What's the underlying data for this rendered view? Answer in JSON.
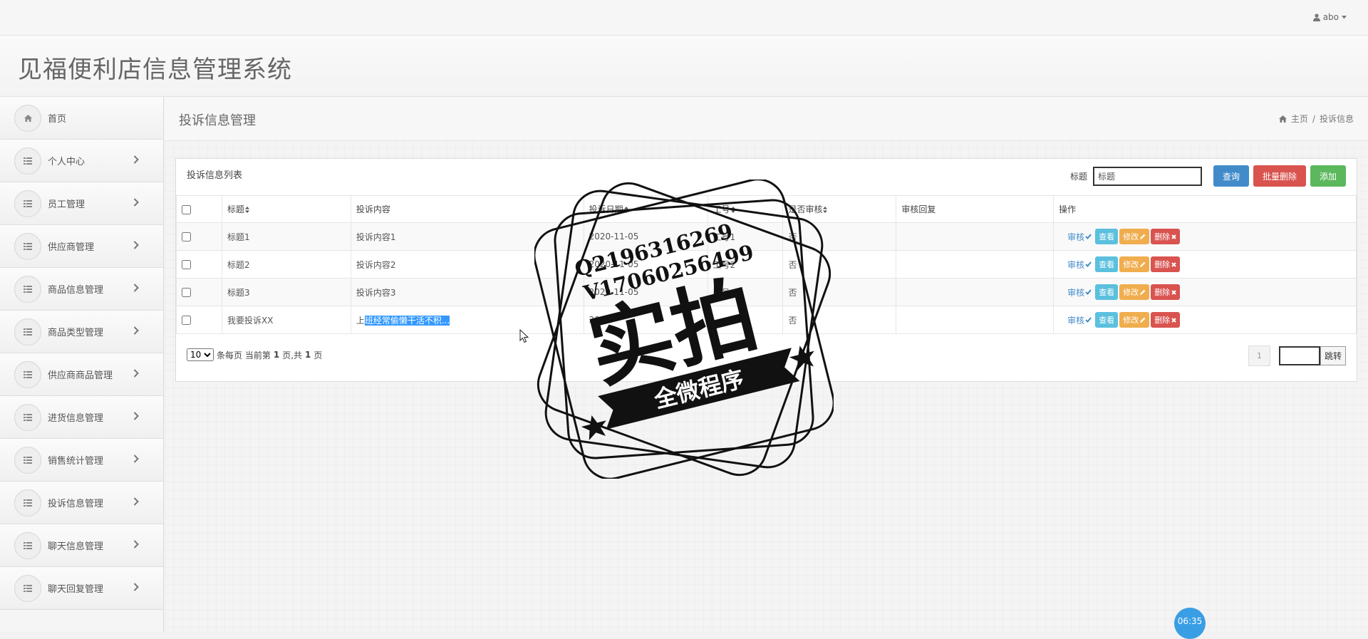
{
  "topbar": {
    "user": "abo"
  },
  "header": {
    "title": "见福便利店信息管理系统"
  },
  "sidebar": {
    "items": [
      {
        "label": "首页",
        "icon": "home-icon",
        "has_children": false
      },
      {
        "label": "个人中心",
        "icon": "grid-icon",
        "has_children": true
      },
      {
        "label": "员工管理",
        "icon": "grid-icon",
        "has_children": true
      },
      {
        "label": "供应商管理",
        "icon": "grid-icon",
        "has_children": true
      },
      {
        "label": "商品信息管理",
        "icon": "grid-icon",
        "has_children": true
      },
      {
        "label": "商品类型管理",
        "icon": "grid-icon",
        "has_children": true
      },
      {
        "label": "供应商商品管理",
        "icon": "grid-icon",
        "has_children": true
      },
      {
        "label": "进货信息管理",
        "icon": "grid-icon",
        "has_children": true
      },
      {
        "label": "销售统计管理",
        "icon": "grid-icon",
        "has_children": true
      },
      {
        "label": "投诉信息管理",
        "icon": "grid-icon",
        "has_children": true
      },
      {
        "label": "聊天信息管理",
        "icon": "grid-icon",
        "has_children": true
      },
      {
        "label": "聊天回复管理",
        "icon": "grid-icon",
        "has_children": true
      }
    ]
  },
  "page": {
    "title": "投诉信息管理",
    "breadcrumb": {
      "home": "主页",
      "current": "投诉信息"
    }
  },
  "panel": {
    "title": "投诉信息列表",
    "search": {
      "label": "标题",
      "value": "标题"
    },
    "buttons": {
      "query": "查询",
      "batch_delete": "批量删除",
      "add": "添加"
    }
  },
  "table": {
    "headers": {
      "title": "标题",
      "content": "投诉内容",
      "date": "投诉日期",
      "job": "工号",
      "reviewed": "是否审核",
      "reply": "审核回复",
      "ops": "操作"
    },
    "rows": [
      {
        "title": "标题1",
        "content": "投诉内容1",
        "content_rest": "",
        "date": "2020-11-05",
        "job": "工号1",
        "reviewed": "否",
        "reply": ""
      },
      {
        "title": "标题2",
        "content": "投诉内容2",
        "content_rest": "",
        "date": "2020-11-05",
        "job": "工号2",
        "reviewed": "否",
        "reply": ""
      },
      {
        "title": "标题3",
        "content": "投诉内容3",
        "content_rest": "",
        "date": "2020-11-05",
        "job": "工号",
        "reviewed": "否",
        "reply": ""
      },
      {
        "title": "我要投诉XX",
        "content": "上",
        "content_rest": "班经常偷懒干活不积...",
        "date": "20",
        "job": "",
        "reviewed": "否",
        "reply": ""
      }
    ],
    "actions": {
      "review": "审核",
      "view": "查看",
      "edit": "修改",
      "delete": "删除"
    }
  },
  "pager": {
    "page_size": "10",
    "info_prefix": "条每页 当前第",
    "current_page": "1",
    "info_mid": "页,共",
    "total_pages": "1",
    "info_suffix": "页",
    "page_button": "1",
    "jump": "跳转"
  },
  "watermark": {
    "line1": "Q2196316269",
    "line2": "V17060256499",
    "main": "实拍",
    "banner": "全微程序"
  },
  "clock": "06:35"
}
